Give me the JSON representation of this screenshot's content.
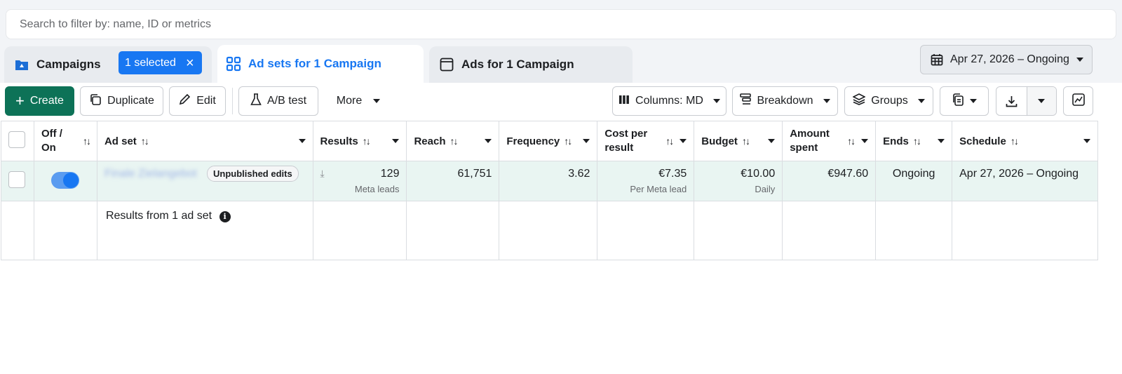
{
  "search": {
    "placeholder": "Search to filter by: name, ID or metrics"
  },
  "tabs": {
    "campaigns": "Campaigns",
    "selected": "1 selected",
    "adsets": "Ad sets for 1 Campaign",
    "ads": "Ads for 1 Campaign"
  },
  "date_range": "Apr 27, 2026 – Ongoing",
  "toolbar": {
    "create": "Create",
    "duplicate": "Duplicate",
    "edit": "Edit",
    "ab_test": "A/B test",
    "more": "More",
    "columns": "Columns: MD",
    "breakdown": "Breakdown",
    "groups": "Groups"
  },
  "columns": {
    "offon_1": "Off /",
    "offon_2": "On",
    "adset": "Ad set",
    "results": "Results",
    "reach": "Reach",
    "frequency": "Frequency",
    "cost_1": "Cost per",
    "cost_2": "result",
    "budget": "Budget",
    "amount_1": "Amount",
    "amount_2": "spent",
    "ends": "Ends",
    "schedule": "Schedule"
  },
  "row": {
    "adset_name": "Finale Zielangebot",
    "badge": "Unpublished edits",
    "results": "129",
    "results_sub": "Meta leads",
    "reach": "61,751",
    "frequency": "3.62",
    "cost": "€7.35",
    "cost_sub": "Per Meta lead",
    "budget": "€10.00",
    "budget_sub": "Daily",
    "amount": "€947.60",
    "ends": "Ongoing",
    "schedule": "Apr 27, 2026 – Ongoing"
  },
  "footer": {
    "results_label": "Results from 1 ad set"
  },
  "colors": {
    "accent": "#1877f2",
    "create_bg": "#0d7257",
    "row_highlight": "#e9f5f2"
  }
}
